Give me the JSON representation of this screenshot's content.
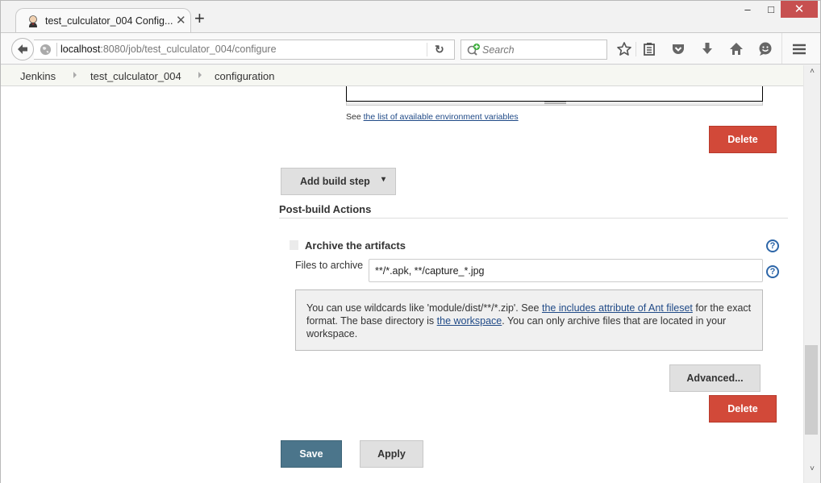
{
  "browser": {
    "tab": {
      "title": "test_culculator_004 Config...",
      "favicon": "jenkins-butler-icon"
    },
    "new_tab_label": "+",
    "window_controls": {
      "minimize": "–",
      "maximize": "□",
      "close": "✕"
    },
    "url": {
      "host": "localhost",
      "rest": ":8080/job/test_culculator_004/configure"
    },
    "reload_label": "↻",
    "search_placeholder": "Search",
    "toolbar_icons": [
      "bookmark-star-icon",
      "reading-list-icon",
      "pocket-icon",
      "download-icon",
      "home-icon",
      "hello-chat-icon",
      "menu-hamburger-icon"
    ]
  },
  "breadcrumb": [
    "Jenkins",
    "test_culculator_004",
    "configuration"
  ],
  "build_step": {
    "env_note_prefix": "See ",
    "env_note_link": "the list of available environment variables",
    "delete_label": "Delete"
  },
  "add_build_step": {
    "label": "Add build step",
    "arrow": "▾"
  },
  "post_build": {
    "section_title": "Post-build Actions",
    "archive": {
      "title": "Archive the artifacts",
      "files_label": "Files to archive",
      "files_value": "**/*.apk, **/capture_*.jpg",
      "help": {
        "t1": "You can use wildcards like 'module/dist/**/*.zip'. See ",
        "link1": "the includes attribute of Ant fileset",
        "t2": " for the exact format. The base directory is ",
        "link2": "the workspace",
        "t3": ". You can only archive files that are located in your workspace."
      },
      "advanced_label": "Advanced...",
      "delete_label": "Delete"
    }
  },
  "footer": {
    "save_label": "Save",
    "apply_label": "Apply"
  },
  "help_glyph": "?",
  "scroll": {
    "up": "˄",
    "down": "˅",
    "position_fraction": 0.78
  },
  "colors": {
    "delete": "#d24939",
    "save": "#4b758b",
    "link": "#204a87",
    "help": "#2d66a8"
  }
}
